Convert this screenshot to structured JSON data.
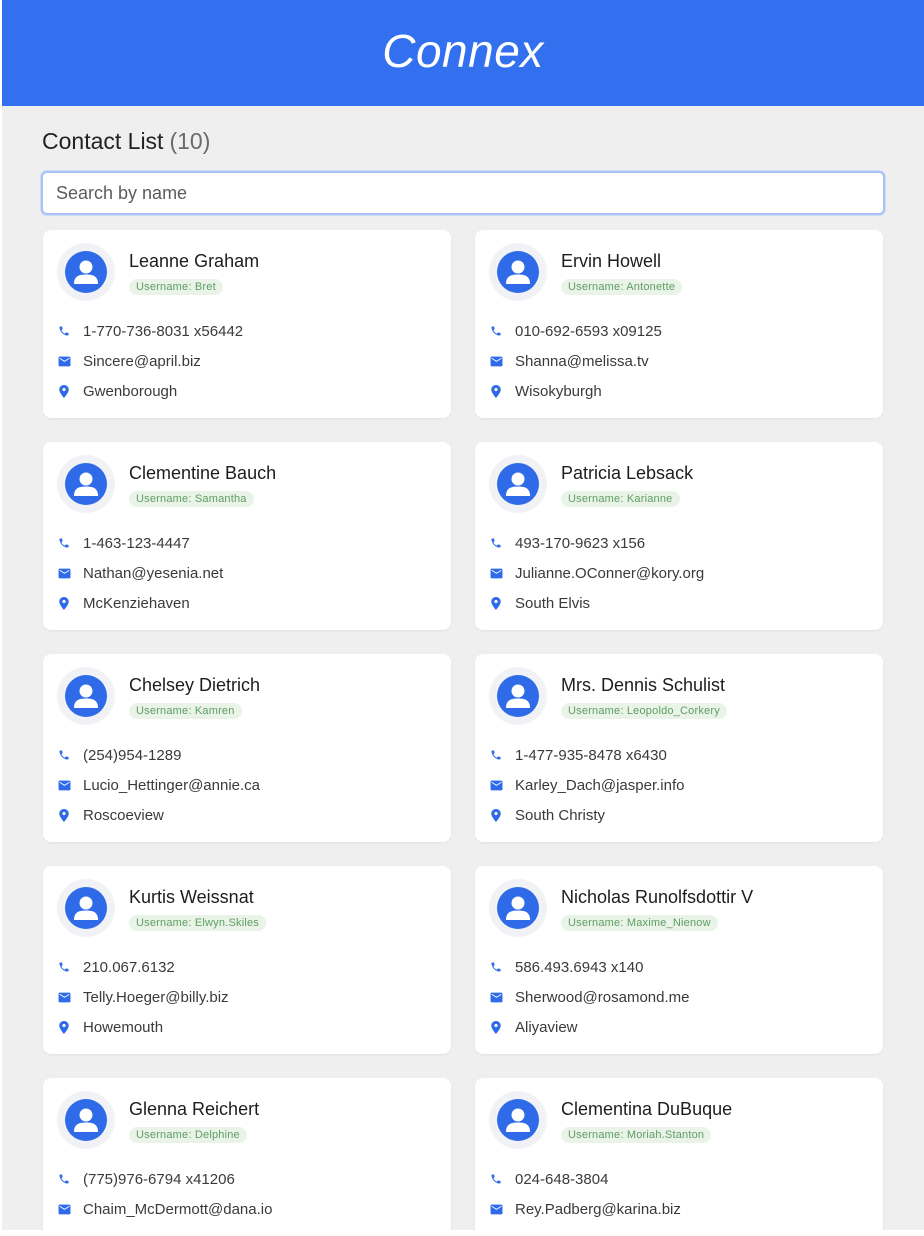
{
  "app": {
    "title": "Connex"
  },
  "list": {
    "title": "Contact List",
    "count": "(10)"
  },
  "search": {
    "placeholder": "Search by name"
  },
  "username_prefix": "Username: ",
  "colors": {
    "accent": "#3370ef",
    "badge_bg": "#e9f3e8",
    "badge_text": "#5e9e61"
  },
  "icons": {
    "phone": "phone-icon",
    "email": "email-icon",
    "location": "location-pin-icon",
    "avatar": "user-avatar-icon"
  },
  "contacts": [
    {
      "name": "Leanne Graham",
      "username": "Username: Bret",
      "phone": "1-770-736-8031 x56442",
      "email": "Sincere@april.biz",
      "city": "Gwenborough"
    },
    {
      "name": "Ervin Howell",
      "username": "Username: Antonette",
      "phone": "010-692-6593 x09125",
      "email": "Shanna@melissa.tv",
      "city": "Wisokyburgh"
    },
    {
      "name": "Clementine Bauch",
      "username": "Username: Samantha",
      "phone": "1-463-123-4447",
      "email": "Nathan@yesenia.net",
      "city": "McKenziehaven"
    },
    {
      "name": "Patricia Lebsack",
      "username": "Username: Karianne",
      "phone": "493-170-9623 x156",
      "email": "Julianne.OConner@kory.org",
      "city": "South Elvis"
    },
    {
      "name": "Chelsey Dietrich",
      "username": "Username: Kamren",
      "phone": "(254)954-1289",
      "email": "Lucio_Hettinger@annie.ca",
      "city": "Roscoeview"
    },
    {
      "name": "Mrs. Dennis Schulist",
      "username": "Username: Leopoldo_Corkery",
      "phone": "1-477-935-8478 x6430",
      "email": "Karley_Dach@jasper.info",
      "city": "South Christy"
    },
    {
      "name": "Kurtis Weissnat",
      "username": "Username: Elwyn.Skiles",
      "phone": "210.067.6132",
      "email": "Telly.Hoeger@billy.biz",
      "city": "Howemouth"
    },
    {
      "name": "Nicholas Runolfsdottir V",
      "username": "Username: Maxime_Nienow",
      "phone": "586.493.6943 x140",
      "email": "Sherwood@rosamond.me",
      "city": "Aliyaview"
    },
    {
      "name": "Glenna Reichert",
      "username": "Username: Delphine",
      "phone": "(775)976-6794 x41206",
      "email": "Chaim_McDermott@dana.io"
    },
    {
      "name": "Clementina DuBuque",
      "username": "Username: Moriah.Stanton",
      "phone": "024-648-3804",
      "email": "Rey.Padberg@karina.biz"
    }
  ]
}
